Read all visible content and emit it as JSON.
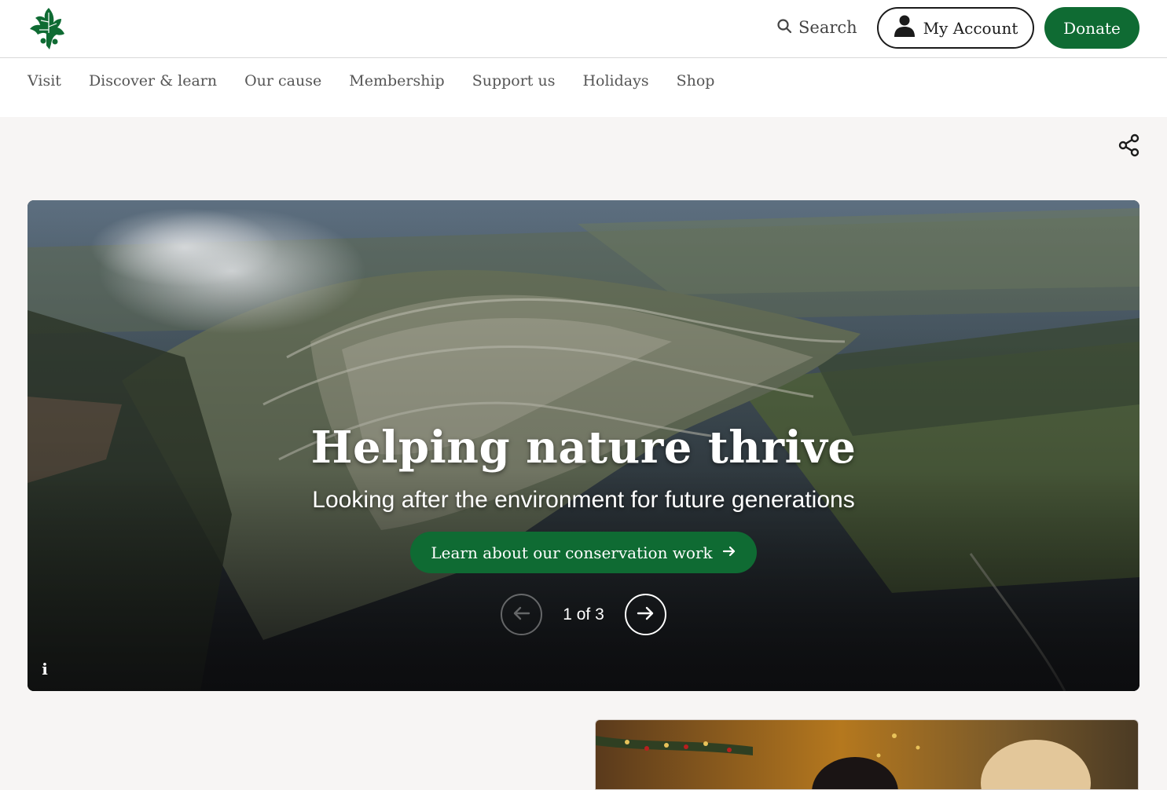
{
  "header": {
    "search_label": "Search",
    "account_label": "My Account",
    "donate_label": "Donate"
  },
  "nav": {
    "items": [
      {
        "label": "Visit"
      },
      {
        "label": "Discover & learn"
      },
      {
        "label": "Our cause"
      },
      {
        "label": "Membership"
      },
      {
        "label": "Support us"
      },
      {
        "label": "Holidays"
      },
      {
        "label": "Shop"
      }
    ]
  },
  "hero": {
    "title": "Helping nature thrive",
    "subtitle": "Looking after the environment for future generations",
    "cta_label": "Learn about our conservation work",
    "counter": "1 of 3",
    "info_label": "i"
  },
  "colors": {
    "brand_green": "#0f6b33",
    "page_background": "#f7f5f4",
    "header_background": "#ffffff",
    "text_dark": "#1b1b1b"
  },
  "icons": {
    "logo": "oak-leaf-logo-icon",
    "search": "search-icon",
    "account": "user-icon",
    "share": "share-icon",
    "cta_arrow": "arrow-right-icon",
    "prev": "arrow-left-icon",
    "next": "arrow-right-icon",
    "info": "info-icon"
  }
}
